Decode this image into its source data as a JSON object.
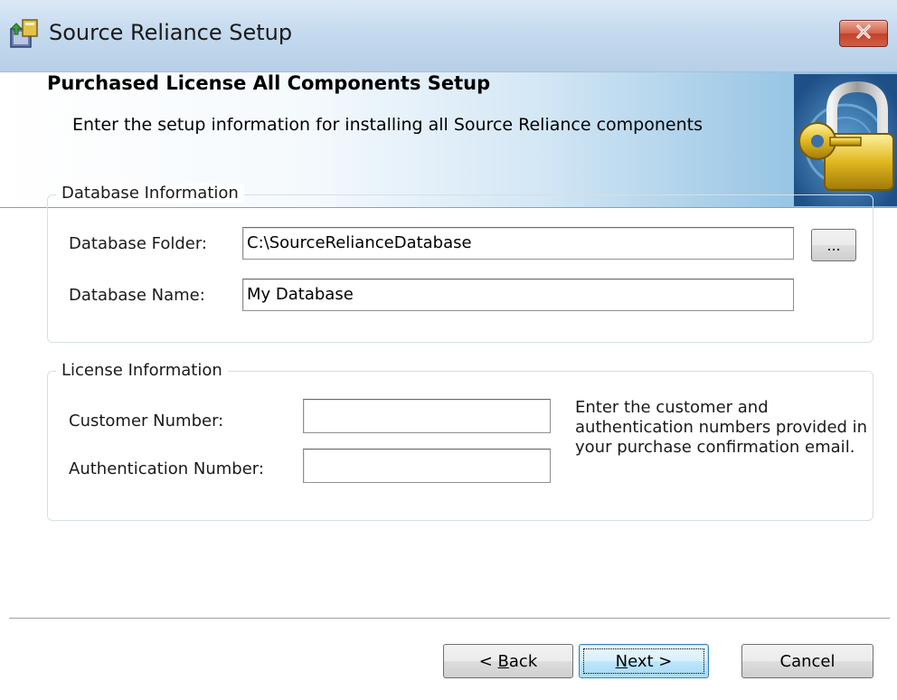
{
  "window": {
    "title": "Source Reliance Setup",
    "icons": {
      "app": "installer-icon",
      "close": "close-icon",
      "banner": "padlock-key-icon"
    },
    "colors": {
      "close_red": "#c2422a",
      "banner_blue": "#7fb8df"
    }
  },
  "banner": {
    "title": "Purchased License All Components Setup",
    "subtitle": "Enter the setup information for installing all Source Reliance components"
  },
  "database_group": {
    "label": "Database Information",
    "folder_label": "Database Folder:",
    "folder_value": "C:\\SourceRelianceDatabase",
    "browse_label": "...",
    "name_label": "Database Name:",
    "name_value": "My Database"
  },
  "license_group": {
    "label": "License Information",
    "customer_label": "Customer Number:",
    "customer_value": "",
    "auth_label": "Authentication Number:",
    "auth_value": "",
    "note": "Enter the customer and authentication numbers provided in your purchase confirmation email."
  },
  "buttons": {
    "back": {
      "mnemonic": "B",
      "before": "< ",
      "after": "ack"
    },
    "next": {
      "mnemonic": "N",
      "before": "",
      "after": "ext >"
    },
    "cancel": "Cancel"
  }
}
